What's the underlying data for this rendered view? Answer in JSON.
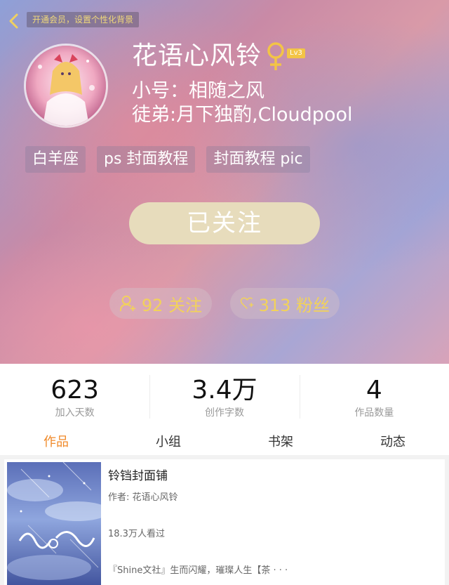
{
  "header": {
    "back_icon": "chevron-left-icon",
    "vip_banner": "开通会员，设置个性化背景"
  },
  "profile": {
    "avatar_icon": "avatar-illustration",
    "name": "花语心风铃",
    "gender_icon": "female-icon",
    "gender_color": "#f3c446",
    "level": "Lv3",
    "alt_account": "小号：相随之风",
    "disciples": "徒弟:月下独酌,Cloudpool",
    "tags": [
      "白羊座",
      "ps 封面教程",
      "封面教程 pic"
    ]
  },
  "follow_button": {
    "label": "已关注",
    "color": "#e7dcbc"
  },
  "social": {
    "following": {
      "icon": "person-add-icon",
      "label": "92 关注"
    },
    "fans": {
      "icon": "heart-plus-icon",
      "label": "313 粉丝"
    },
    "accent": "#f2d25a"
  },
  "stats": [
    {
      "value": "623",
      "label": "加入天数"
    },
    {
      "value": "3.4万",
      "label": "创作字数"
    },
    {
      "value": "4",
      "label": "作品数量"
    }
  ],
  "tabs": [
    {
      "label": "作品",
      "active": true
    },
    {
      "label": "小组",
      "active": false
    },
    {
      "label": "书架",
      "active": false
    },
    {
      "label": "动态",
      "active": false
    }
  ],
  "tab_active_color": "#f08a2a",
  "works": [
    {
      "title": "铃铛封面铺",
      "author": "作者: 花语心风铃",
      "views": "18.3万人看过",
      "description": "『Shine文社』生而闪耀，璀璨人生【茶 · · ·"
    }
  ]
}
